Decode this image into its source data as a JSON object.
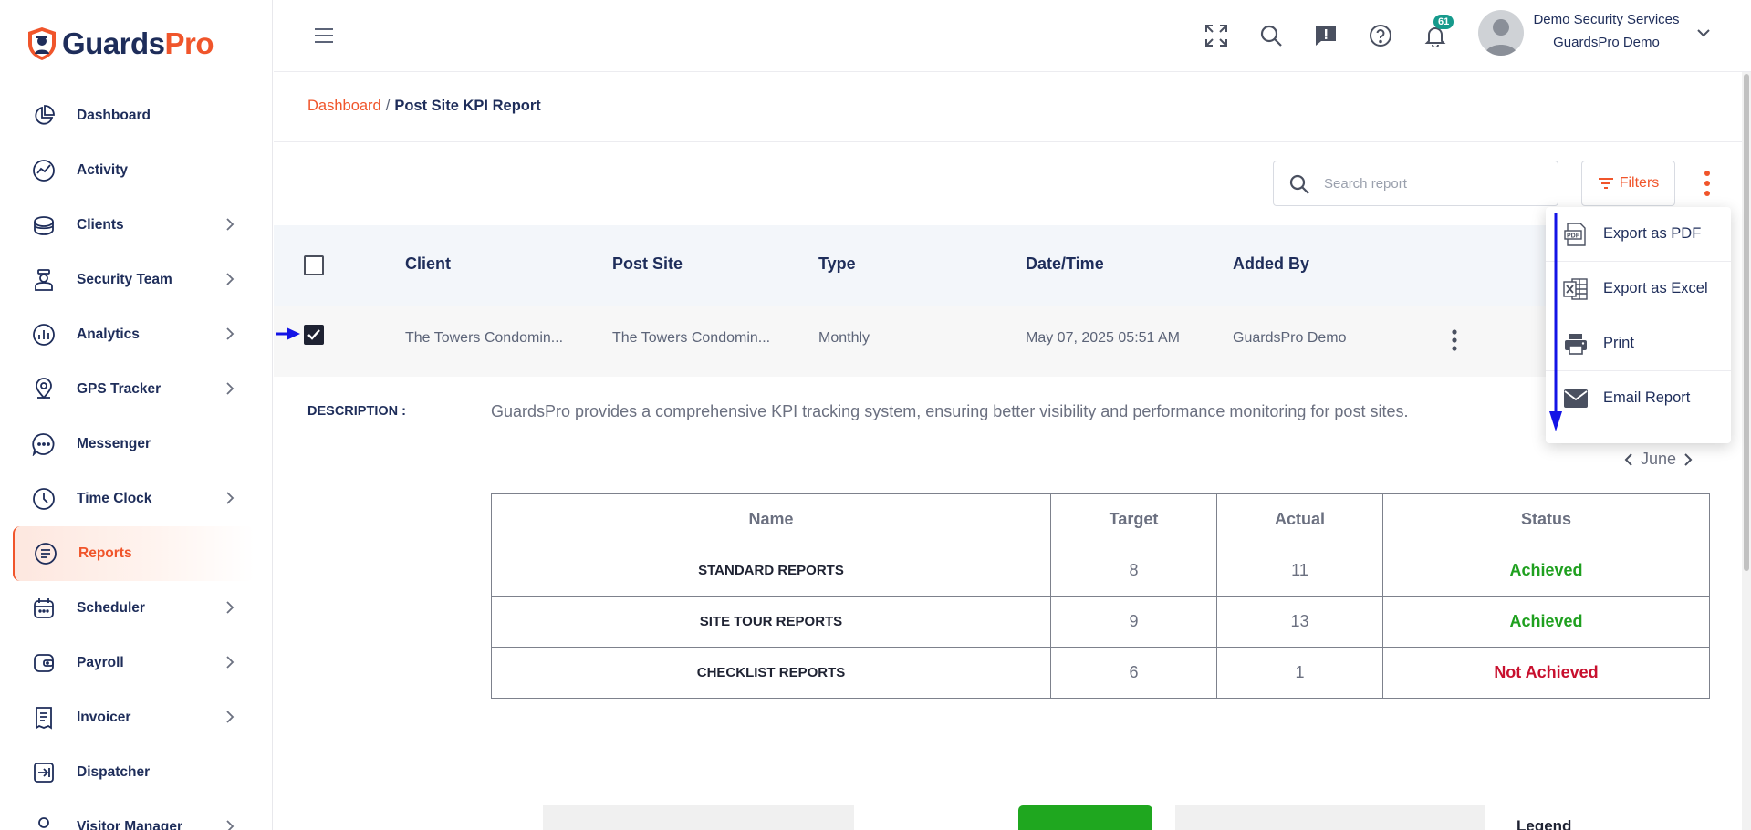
{
  "brand": {
    "name_part1": "Guards",
    "name_part2": "Pro",
    "primary_color": "#f0552b",
    "navy_color": "#1e2d5a"
  },
  "sidebar": {
    "items": [
      {
        "label": "Dashboard",
        "icon": "pie-chart-icon",
        "has_chevron": false,
        "active": false
      },
      {
        "label": "Activity",
        "icon": "activity-icon",
        "has_chevron": false,
        "active": false
      },
      {
        "label": "Clients",
        "icon": "clients-icon",
        "has_chevron": true,
        "active": false
      },
      {
        "label": "Security Team",
        "icon": "guard-icon",
        "has_chevron": true,
        "active": false
      },
      {
        "label": "Analytics",
        "icon": "analytics-icon",
        "has_chevron": true,
        "active": false
      },
      {
        "label": "GPS Tracker",
        "icon": "location-pin-icon",
        "has_chevron": true,
        "active": false
      },
      {
        "label": "Messenger",
        "icon": "chat-icon",
        "has_chevron": false,
        "active": false
      },
      {
        "label": "Time Clock",
        "icon": "clock-icon",
        "has_chevron": true,
        "active": false
      },
      {
        "label": "Reports",
        "icon": "report-icon",
        "has_chevron": false,
        "active": true
      },
      {
        "label": "Scheduler",
        "icon": "calendar-icon",
        "has_chevron": true,
        "active": false
      },
      {
        "label": "Payroll",
        "icon": "wallet-icon",
        "has_chevron": true,
        "active": false
      },
      {
        "label": "Invoicer",
        "icon": "invoice-icon",
        "has_chevron": true,
        "active": false
      },
      {
        "label": "Dispatcher",
        "icon": "dispatch-icon",
        "has_chevron": false,
        "active": false
      },
      {
        "label": "Visitor Manager",
        "icon": "visitor-icon",
        "has_chevron": true,
        "active": false
      }
    ]
  },
  "header": {
    "notification_count": "61",
    "user_name": "Demo Security Services",
    "user_org": "GuardsPro Demo"
  },
  "breadcrumb": {
    "root": "Dashboard",
    "separator": "/",
    "current": "Post Site KPI Report"
  },
  "toolbar": {
    "search_placeholder": "Search report",
    "filters_label": "Filters"
  },
  "table": {
    "headers": [
      "Client",
      "Post Site",
      "Type",
      "Date/Time",
      "Added By"
    ],
    "rows": [
      {
        "client": "The Towers Condomin...",
        "post_site": "The Towers Condomin...",
        "type": "Monthly",
        "datetime": "May 07, 2025 05:51 AM",
        "added_by": "GuardsPro Demo",
        "checked": true
      }
    ]
  },
  "description": {
    "label": "DESCRIPTION :",
    "text": "GuardsPro provides a comprehensive KPI tracking system, ensuring better visibility and performance monitoring for post sites."
  },
  "month_nav": {
    "label": "June"
  },
  "kpi_table": {
    "headers": [
      "Name",
      "Target",
      "Actual",
      "Status"
    ],
    "rows": [
      {
        "name": "STANDARD REPORTS",
        "target": "8",
        "actual": "11",
        "status": "Achieved",
        "status_color": "#1fa01f"
      },
      {
        "name": "SITE TOUR REPORTS",
        "target": "9",
        "actual": "13",
        "status": "Achieved",
        "status_color": "#1fa01f"
      },
      {
        "name": "CHECKLIST REPORTS",
        "target": "6",
        "actual": "1",
        "status": "Not Achieved",
        "status_color": "#c8102e"
      }
    ]
  },
  "legend_label": "Legend",
  "export_menu": {
    "items": [
      {
        "label": "Export as PDF",
        "icon": "pdf-icon"
      },
      {
        "label": "Export as Excel",
        "icon": "excel-icon"
      },
      {
        "label": "Print",
        "icon": "printer-icon"
      },
      {
        "label": "Email Report",
        "icon": "email-icon"
      }
    ]
  }
}
